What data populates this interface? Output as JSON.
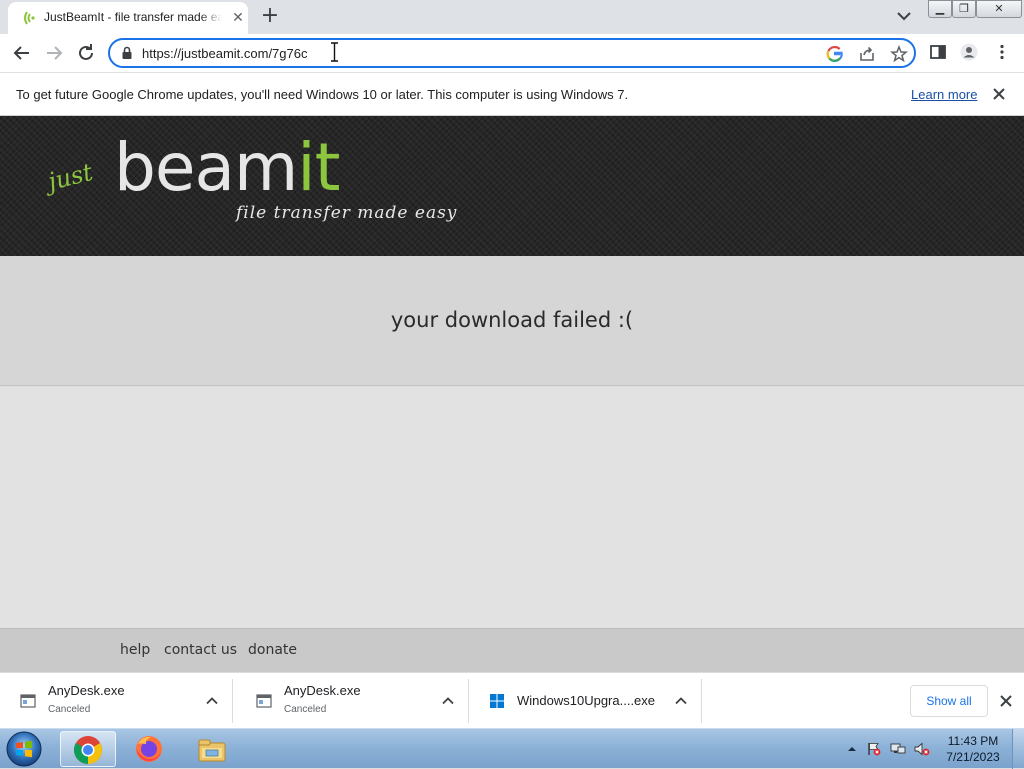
{
  "browser": {
    "tab": {
      "title": "JustBeamIt - file transfer made easy"
    },
    "address_bar": {
      "url": "https://justbeamit.com/7g76c"
    }
  },
  "infobar": {
    "message": "To get future Google Chrome updates, you'll need Windows 10 or later. This computer is using Windows 7.",
    "link": "Learn more"
  },
  "page": {
    "logo": {
      "just": "just",
      "beam": "beam",
      "it": "it",
      "tagline": "file transfer made easy"
    },
    "status_message": "your download failed :(",
    "footer_links": [
      "help",
      "contact us",
      "donate"
    ]
  },
  "downloads": {
    "items": [
      {
        "name": "AnyDesk.exe",
        "status": "Canceled",
        "icon": "exe-file-icon"
      },
      {
        "name": "AnyDesk.exe",
        "status": "Canceled",
        "icon": "exe-file-icon"
      },
      {
        "name": "Windows10Upgra....exe",
        "status": "",
        "icon": "windows-logo-icon"
      }
    ],
    "show_all": "Show all"
  },
  "taskbar": {
    "apps": [
      "chrome-icon",
      "firefox-icon",
      "file-explorer-icon"
    ],
    "clock": {
      "time": "11:43 PM",
      "date": "7/21/2023"
    }
  },
  "colors": {
    "accent": "#1a73e8",
    "logo_green": "#8cc63f",
    "banner": "#262626"
  }
}
